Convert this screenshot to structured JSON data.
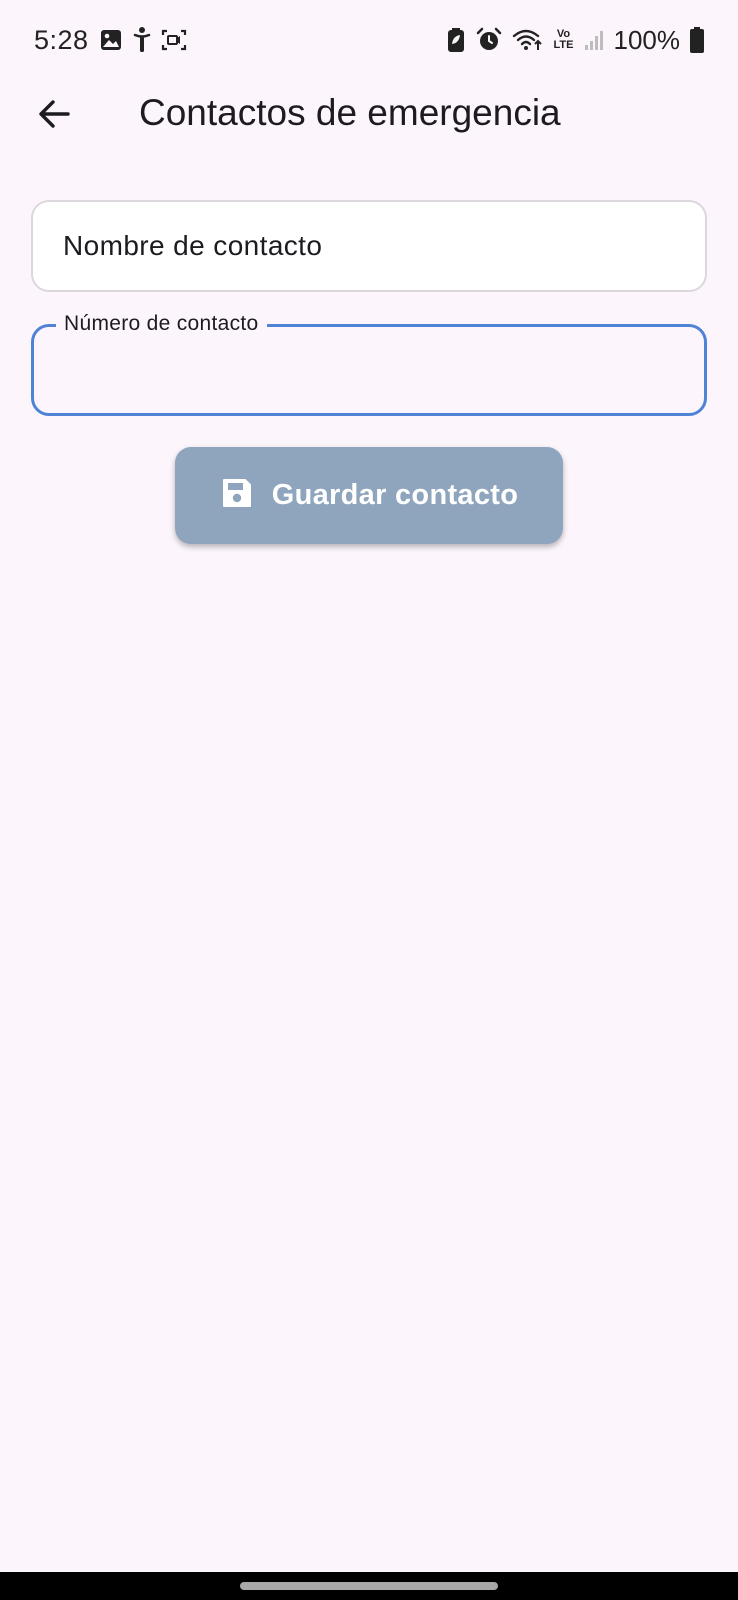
{
  "status_bar": {
    "time": "5:28",
    "left_icons": [
      "gallery-icon",
      "accessibility-icon",
      "screen-record-icon"
    ],
    "right_icons": [
      "battery-saver-icon",
      "alarm-icon",
      "wifi-icon",
      "volte-icon",
      "signal-icon",
      "battery-icon"
    ],
    "volte_top": "Vo",
    "volte_bottom": "LTE",
    "battery_percent": "100%"
  },
  "app_bar": {
    "back_icon": "arrow-back-icon",
    "title": "Contactos de emergencia"
  },
  "form": {
    "name_field": {
      "placeholder": "Nombre de contacto",
      "value": ""
    },
    "number_field": {
      "label": "Número de contacto",
      "value": "",
      "focused": true
    },
    "save_button": {
      "icon": "save-icon",
      "label": "Guardar contacto"
    }
  },
  "colors": {
    "background": "#fcf6fc",
    "focus_border": "#4f83d6",
    "button_disabled": "#8fa5bd",
    "text": "#1d1b20"
  }
}
